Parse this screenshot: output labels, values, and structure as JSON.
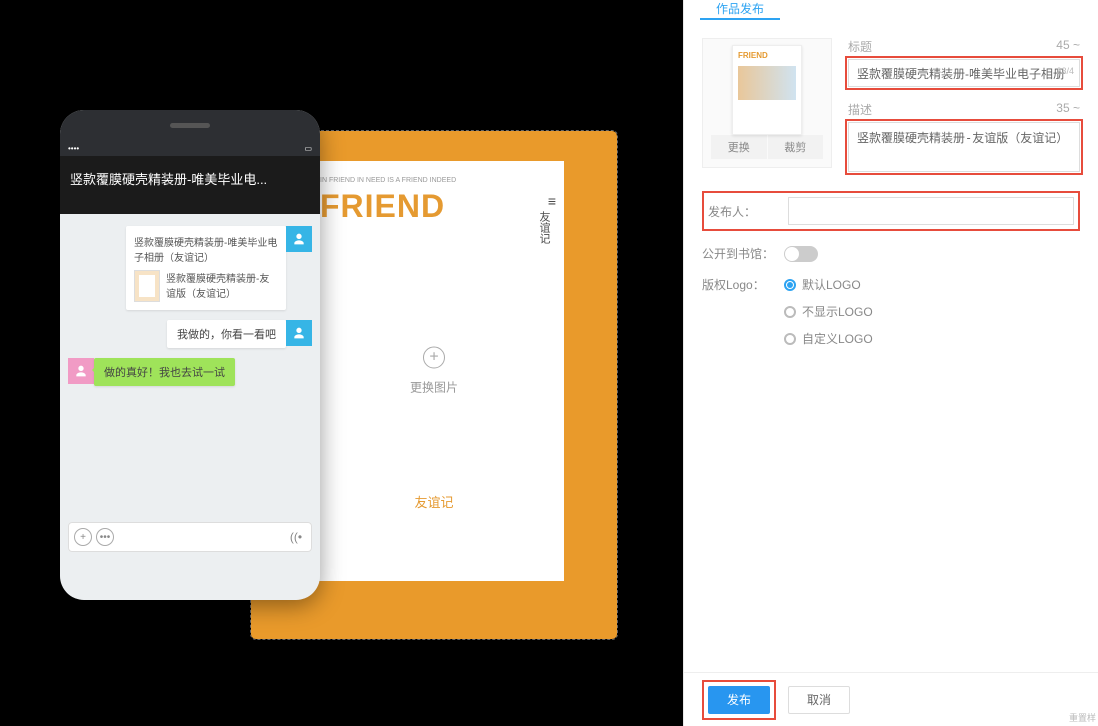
{
  "tab": {
    "title": "作品发布"
  },
  "thumb": {
    "replace": "更换",
    "crop": "裁剪",
    "mini_title": "FRIEND"
  },
  "form": {
    "title_label": "标题",
    "title_counter": "45 ~",
    "title_inline_counter": "23/4",
    "title_value": "竖款覆膜硬壳精装册-唯美毕业电子相册（友",
    "desc_label": "描述",
    "desc_counter": "35 ~",
    "desc_value": "竖款覆膜硬壳精装册-友谊版（友谊记）",
    "publisher_label": "发布人：",
    "publisher_value": "",
    "public_label": "公开到书馆：",
    "logo_label": "版权Logo：",
    "logo_options": [
      "默认LOGO",
      "不显示LOGO",
      "自定义LOGO"
    ]
  },
  "footer": {
    "publish": "发布",
    "cancel": "取消",
    "reset": "重置样"
  },
  "phone": {
    "header": "竖款覆膜硬壳精装册-唯美毕业电...",
    "card_title": "竖款覆膜硬壳精装册-唯美毕业电子相册（友谊记）",
    "card_sub": "竖款覆膜硬壳精装册-友谊版（友谊记）",
    "msg_out": "我做的，你看一看吧",
    "msg_in": "做的真好！我也去试一试"
  },
  "poster": {
    "subhead": "IN FRIEND IN NEED IS A FRIEND INDEED",
    "title": "FRIEND",
    "side": "友谊记",
    "menu": "≡",
    "center_label": "更换图片",
    "bottom": "友谊记"
  }
}
